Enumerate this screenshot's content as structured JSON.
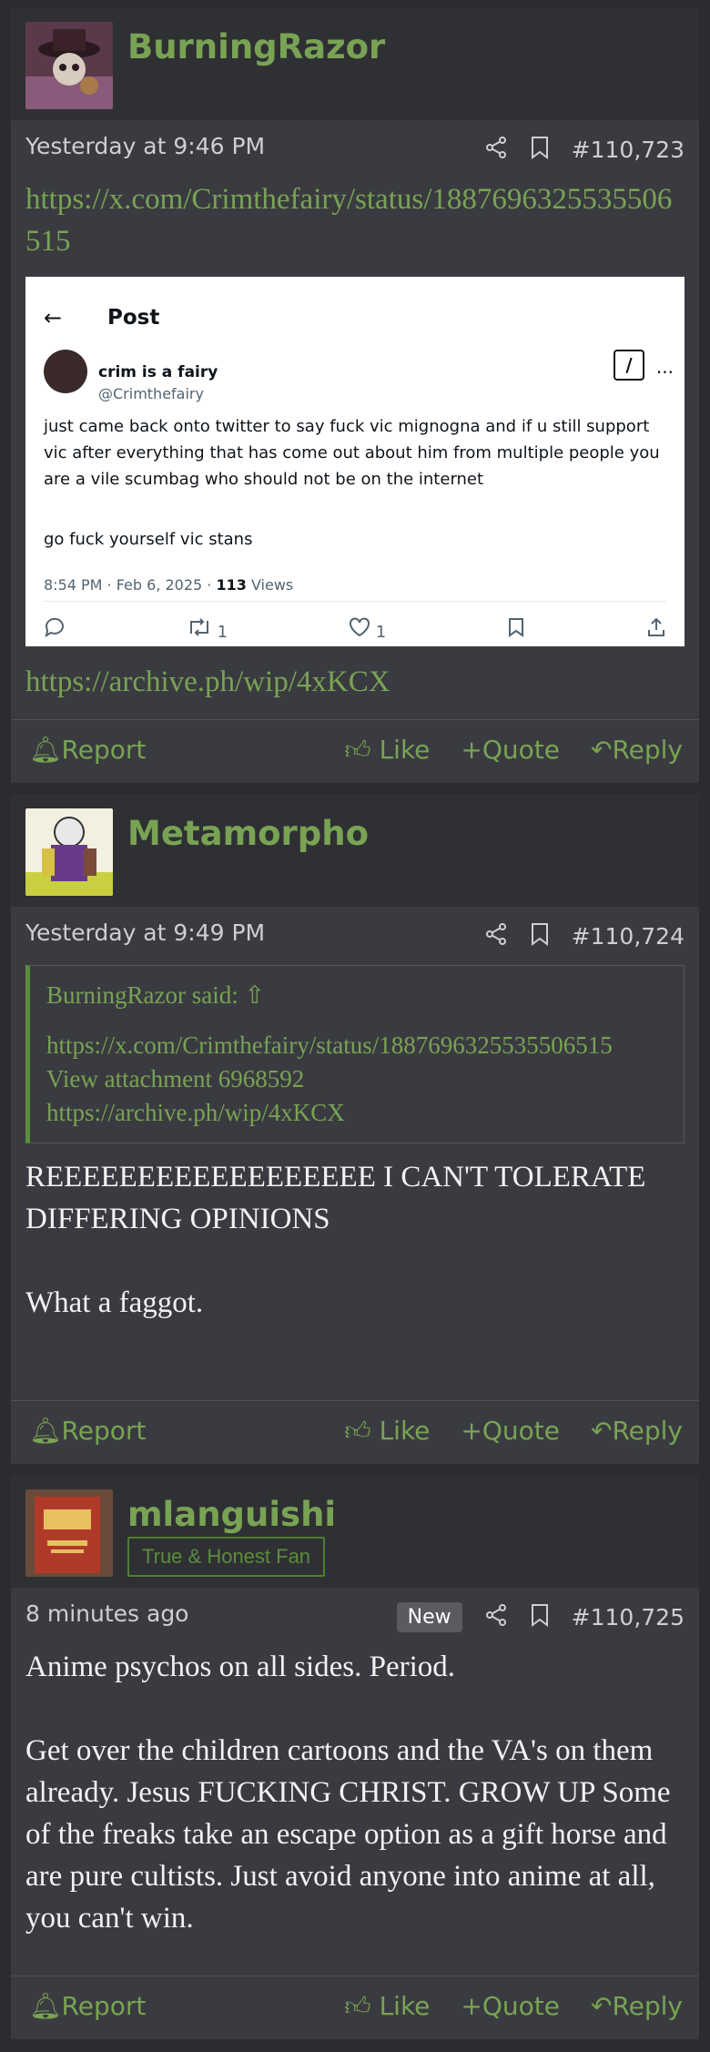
{
  "posts": [
    {
      "username": "BurningRazor",
      "timestamp": "Yesterday at 9:46 PM",
      "post_number": "#110,723",
      "link1": "https://x.com/Crimthefairy/status/1887696325535506515",
      "link2": "https://archive.ph/wip/4xKCX",
      "embed": {
        "title": "Post",
        "display_name": "crim is a fairy",
        "handle": "@Crimthefairy",
        "text": "just came back onto twitter to say fuck vic mignogna and if u still support vic after everything that has come out about him from multiple people you are a vile scumbag who should not be on the internet",
        "text2": "go fuck yourself  vic stans",
        "meta_time": "8:54 PM · Feb 6, 2025 · ",
        "views": "113",
        "views_label": " Views",
        "retweets": "1",
        "likes": "1"
      }
    },
    {
      "username": "Metamorpho",
      "timestamp": "Yesterday at 9:49 PM",
      "post_number": "#110,724",
      "quote": {
        "author_said": "BurningRazor said:",
        "line1": "https://x.com/Crimthefairy/status/1887696325535506515",
        "line2": "View attachment 6968592",
        "line3": "https://archive.ph/wip/4xKCX"
      },
      "body1": "REEEEEEEEEEEEEEEEEE I CAN'T TOLERATE DIFFERING OPINIONS",
      "body2": "What a faggot."
    },
    {
      "username": "mlanguishi",
      "badge": "True & Honest Fan",
      "timestamp": "8 minutes ago",
      "new_label": "New",
      "post_number": "#110,725",
      "body1": "Anime psychos on all sides. Period.",
      "body2": "Get over the children cartoons and the VA's on them already. Jesus FUCKING CHRIST. GROW UP Some of the freaks take an escape option as a gift horse and are pure cultists. Just avoid anyone into anime at all, you can't win."
    }
  ],
  "footer": {
    "report": "Report",
    "like": "Like",
    "quote": "Quote",
    "reply": "Reply"
  }
}
